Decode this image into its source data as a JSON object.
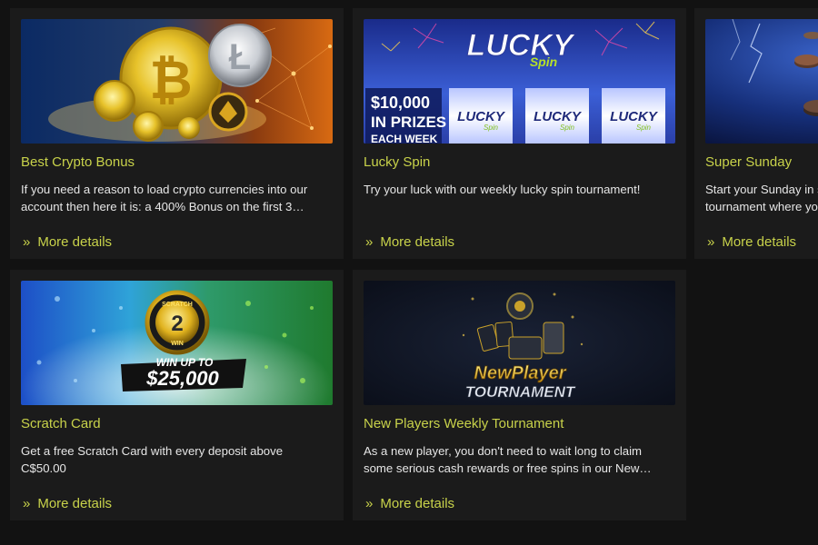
{
  "cards": [
    {
      "title": "Best Crypto Bonus",
      "desc_line1": "If you need a reason to load crypto currencies into our",
      "desc_line2": "account then here it is: a 400% Bonus on the first 3…",
      "more_label": "More details",
      "banner_icon": "crypto-coins-icon"
    },
    {
      "title": "Lucky Spin",
      "desc_line1": "Try your luck with our weekly lucky spin tournament!",
      "desc_line2": "",
      "more_label": "More details",
      "banner_text_main": "LUCKY",
      "banner_text_sub": "Spin",
      "banner_prize_line1": "$10,000",
      "banner_prize_line2": "IN PRIZES",
      "banner_prize_line3": "EACH WEEK",
      "banner_reel_label": "LUCKY"
    },
    {
      "title": "Super Sunday",
      "desc_line1": "Start your Sunday in s",
      "desc_line2": "tournament where yo",
      "more_label": "More details"
    },
    {
      "title": "Scratch Card",
      "desc_line1": "Get a free Scratch Card with every deposit above",
      "desc_line2": "C$50.00",
      "more_label": "More details",
      "banner_badge_top": "SCRATCH",
      "banner_badge_num": "2",
      "banner_badge_bottom": "WIN",
      "banner_win_label": "WIN UP TO",
      "banner_win_amount": "$25,000"
    },
    {
      "title": "New Players Weekly Tournament",
      "desc_line1": "As a new player, you don't need to wait long to claim",
      "desc_line2": "some serious cash rewards or free spins in our New…",
      "more_label": "More details",
      "banner_line1": "NewPlayer",
      "banner_line2": "TOURNAMENT"
    }
  ],
  "colors": {
    "accent": "#c8d24a",
    "card_bg": "#1b1b1b",
    "page_bg": "#121212",
    "text": "#e6e6e6"
  }
}
